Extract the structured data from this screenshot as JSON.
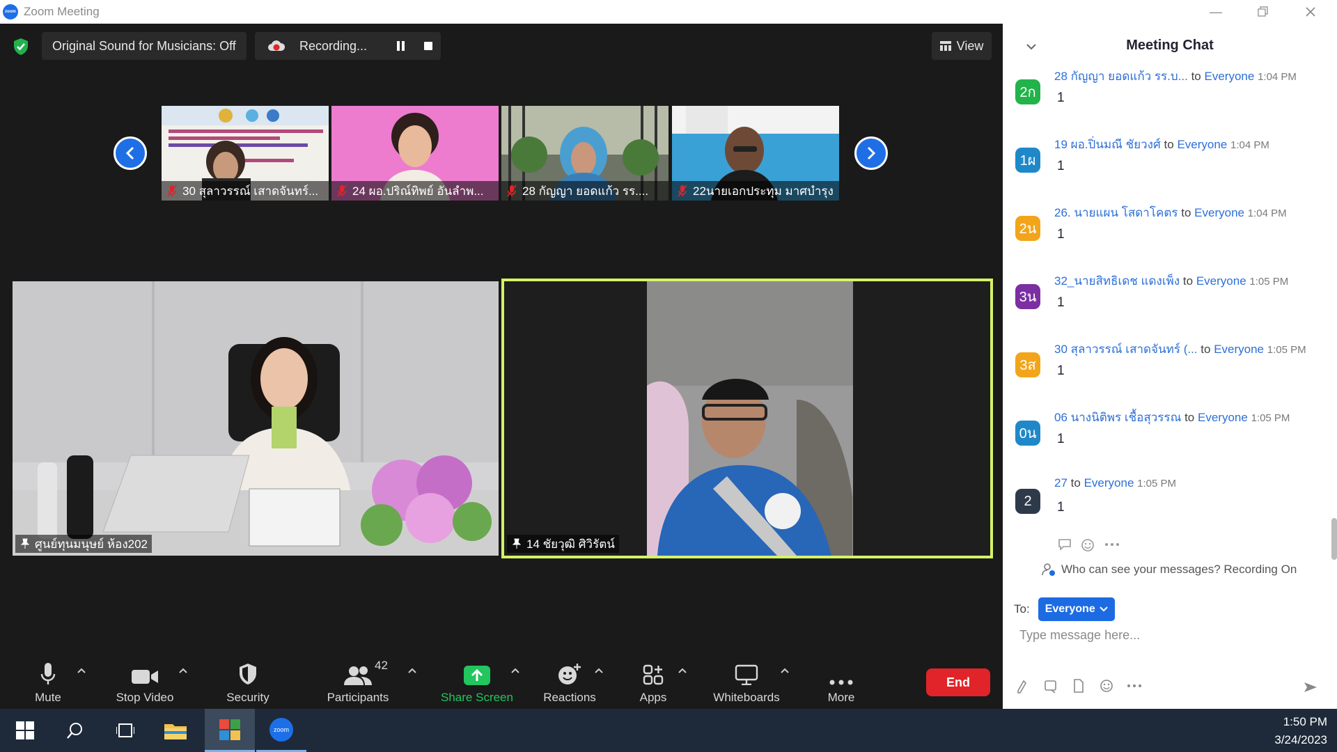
{
  "window": {
    "title": "Zoom Meeting"
  },
  "top_bar": {
    "sound_label": "Original Sound for Musicians: Off",
    "recording_label": "Recording...",
    "view_label": "View"
  },
  "thumbnails": [
    {
      "name": "30 สุลาวรรณ์ เสาดจันทร์..."
    },
    {
      "name": "24 ผอ.ปริณ์ทิพย์ อันลำพ..."
    },
    {
      "name": "28 กัญญา  ยอดแก้ว รร...."
    },
    {
      "name": "22นายเอกประทุม มาศบำรุง"
    }
  ],
  "tiles": [
    {
      "name": "ศูนย์ทุนมนุษย์ ห้อง202"
    },
    {
      "name": "14 ชัยวุฒิ ศิวิรัตน์"
    }
  ],
  "toolbar": {
    "mute": "Mute",
    "stop_video": "Stop Video",
    "security": "Security",
    "participants": "Participants",
    "participants_count": "42",
    "share_screen": "Share Screen",
    "reactions": "Reactions",
    "apps": "Apps",
    "whiteboards": "Whiteboards",
    "more": "More",
    "end": "End"
  },
  "chat": {
    "title": "Meeting Chat",
    "messages": [
      {
        "avatar": "2ก",
        "avatar_color": "#22b34a",
        "sender": "28 กัญญา  ยอดแก้ว รร.บ...",
        "to": "to",
        "recipient": "Everyone",
        "time": "1:04 PM",
        "text": "1"
      },
      {
        "avatar": "1ผ",
        "avatar_color": "#1f88c9",
        "sender": "19 ผอ.ปิ่นมณี ชัยวงศ์",
        "to": "to",
        "recipient": "Everyone",
        "time": "1:04 PM",
        "text": "1"
      },
      {
        "avatar": "2น",
        "avatar_color": "#f2a51a",
        "sender": "26. นายแผน  โสดาโคตร",
        "to": "to",
        "recipient": "Everyone",
        "time": "1:04 PM",
        "text": "1"
      },
      {
        "avatar": "3น",
        "avatar_color": "#7b2fa3",
        "sender": "32_นายสิทธิเดช  แดงเพ็ง",
        "to": "to",
        "recipient": "Everyone",
        "time": "1:05 PM",
        "text": "1"
      },
      {
        "avatar": "3ส",
        "avatar_color": "#f2a51a",
        "sender": "30 สุลาวรรณ์ เสาดจันทร์ (...",
        "to": "to",
        "recipient": "Everyone",
        "time": "1:05 PM",
        "text": "1"
      },
      {
        "avatar": "0น",
        "avatar_color": "#1f88c9",
        "sender": "06 นางนิติพร เชื้อสุวรรณ",
        "to": "to",
        "recipient": "Everyone",
        "time": "1:05 PM",
        "text": "1"
      },
      {
        "avatar": "2",
        "avatar_color": "#2e3a4a",
        "sender": "27",
        "to": "to",
        "recipient": "Everyone",
        "time": "1:05 PM",
        "text": "1"
      }
    ],
    "visibility": "Who can see your messages? Recording On",
    "to_label": "To:",
    "to_value": "Everyone",
    "input_placeholder": "Type message here..."
  },
  "taskbar": {
    "zoom_label": "zoom",
    "time": "1:50 PM",
    "date": "3/24/2023"
  },
  "colors": {
    "accent": "#1e6fe6",
    "end": "#e0242a",
    "share": "#22c55e",
    "active_speaker": "#d4f266"
  }
}
